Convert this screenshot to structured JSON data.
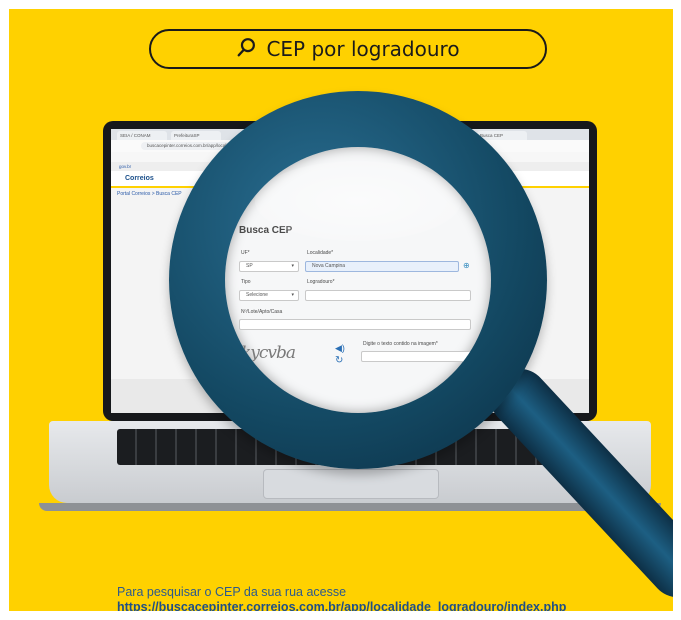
{
  "title": "CEP por logradouro",
  "icons": {
    "search": "search-icon",
    "refresh": "refresh-icon",
    "audio": "audio-icon",
    "info": "info-icon"
  },
  "colors": {
    "background": "#ffd100",
    "handle": "#134862",
    "text_blue": "#1f4f86"
  },
  "browser": {
    "tabs": [
      "SEIA / CONAM",
      "PrefeituraSP",
      "Busca CEP"
    ],
    "address": "buscacepinter.correios.com.br/app/localidade_logradouro/index.php"
  },
  "site": {
    "gov_bar": "gov.br",
    "logo": "Correios",
    "breadcrumb": "Portal Correios > Busca CEP"
  },
  "form": {
    "title": "Busca CEP",
    "uf_label": "UF*",
    "uf_value": "SP",
    "localidade_label": "Localidade*",
    "localidade_value": "Nova Campina",
    "tipo_label": "Tipo",
    "tipo_value": "Selecione",
    "logradouro_label": "Logradouro*",
    "complemento_label": "Nº/Lote/Apto/Casa",
    "captcha_text": "kycvba",
    "captcha_prompt": "Digite o texto contido na imagem*"
  },
  "footer": {
    "line1": "Para pesquisar o CEP da sua rua acesse",
    "url": "https://buscacepinter.correios.com.br/app/localidade_logradouro/index.php"
  }
}
